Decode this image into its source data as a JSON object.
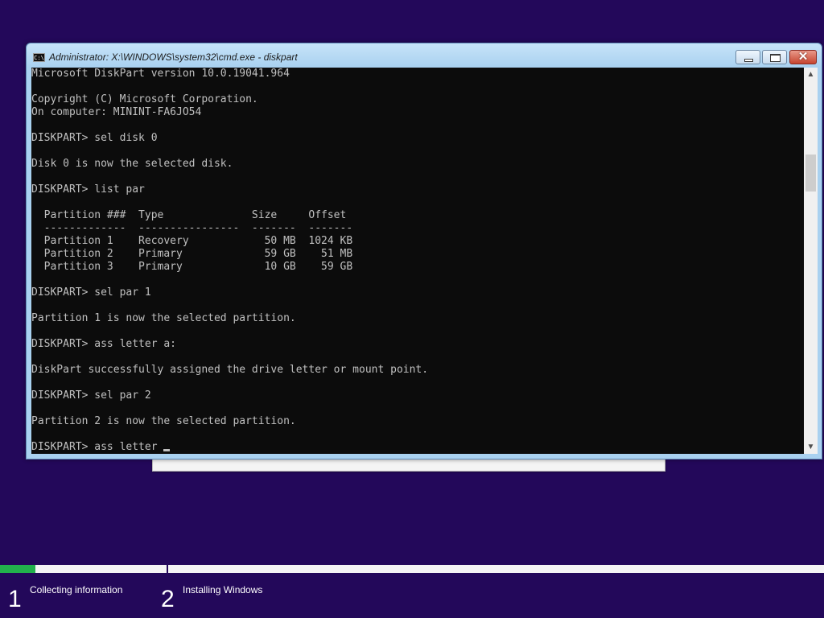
{
  "window": {
    "title": "Administrator: X:\\WINDOWS\\system32\\cmd.exe - diskpart",
    "icon": "cmd-icon",
    "icon_glyph": "C:\\",
    "minimize_icon": "minimize-icon",
    "maximize_icon": "maximize-icon",
    "close_icon": "close-icon",
    "close_glyph": "✕"
  },
  "console": {
    "lines": [
      "Microsoft DiskPart version 10.0.19041.964",
      "",
      "Copyright (C) Microsoft Corporation.",
      "On computer: MININT-FA6JO54",
      "",
      "DISKPART> sel disk 0",
      "",
      "Disk 0 is now the selected disk.",
      "",
      "DISKPART> list par",
      "",
      "  Partition ###  Type              Size     Offset",
      "  -------------  ----------------  -------  -------",
      "  Partition 1    Recovery            50 MB  1024 KB",
      "  Partition 2    Primary             59 GB    51 MB",
      "  Partition 3    Primary             10 GB    59 GB",
      "",
      "DISKPART> sel par 1",
      "",
      "Partition 1 is now the selected partition.",
      "",
      "DISKPART> ass letter a:",
      "",
      "DiskPart successfully assigned the drive letter or mount point.",
      "",
      "DISKPART> sel par 2",
      "",
      "Partition 2 is now the selected partition.",
      ""
    ],
    "current_input": "DISKPART> ass letter "
  },
  "scrollbar": {
    "up_glyph": "▲",
    "down_glyph": "▼"
  },
  "setup": {
    "progress_fraction": 0.043,
    "steps": [
      {
        "number": "1",
        "label": "Collecting information"
      },
      {
        "number": "2",
        "label": "Installing Windows"
      }
    ]
  },
  "colors": {
    "desktop_background": "#23085a",
    "console_background": "#0c0c0c",
    "console_text": "#c0c0c0",
    "progress_fill": "#22b14c"
  }
}
